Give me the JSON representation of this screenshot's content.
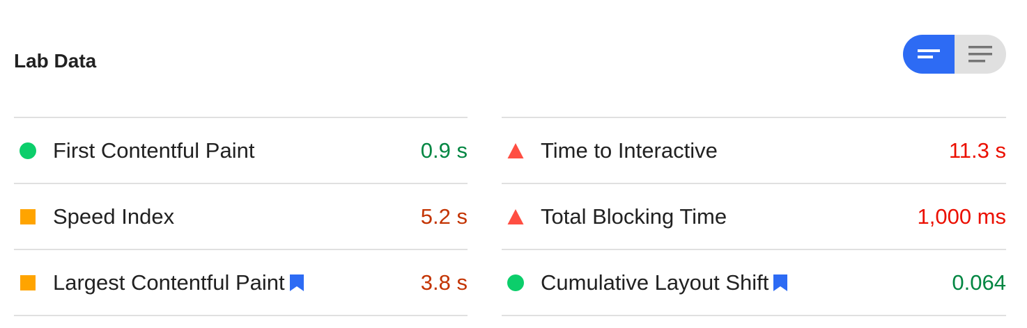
{
  "title": "Lab Data",
  "view_toggle": {
    "options": [
      "compact",
      "expanded"
    ],
    "selected": "compact"
  },
  "colors": {
    "pass": "#0cce6b",
    "pass_text": "#018642",
    "average": "#ffa400",
    "average_text": "#c33300",
    "fail": "#ff4e42",
    "fail_text": "#eb0f00",
    "accent": "#2d6bf4"
  },
  "metrics": {
    "left": [
      {
        "label": "First Contentful Paint",
        "value": "0.9 s",
        "status": "pass",
        "indicator": "circle-icon",
        "bookmarked": false
      },
      {
        "label": "Speed Index",
        "value": "5.2 s",
        "status": "average",
        "indicator": "square-icon",
        "bookmarked": false
      },
      {
        "label": "Largest Contentful Paint",
        "value": "3.8 s",
        "status": "average",
        "indicator": "square-icon",
        "bookmarked": true
      }
    ],
    "right": [
      {
        "label": "Time to Interactive",
        "value": "11.3 s",
        "status": "fail",
        "indicator": "triangle-icon",
        "bookmarked": false
      },
      {
        "label": "Total Blocking Time",
        "value": "1,000 ms",
        "status": "fail",
        "indicator": "triangle-icon",
        "bookmarked": false
      },
      {
        "label": "Cumulative Layout Shift",
        "value": "0.064",
        "status": "pass",
        "indicator": "circle-icon",
        "bookmarked": true
      }
    ]
  }
}
